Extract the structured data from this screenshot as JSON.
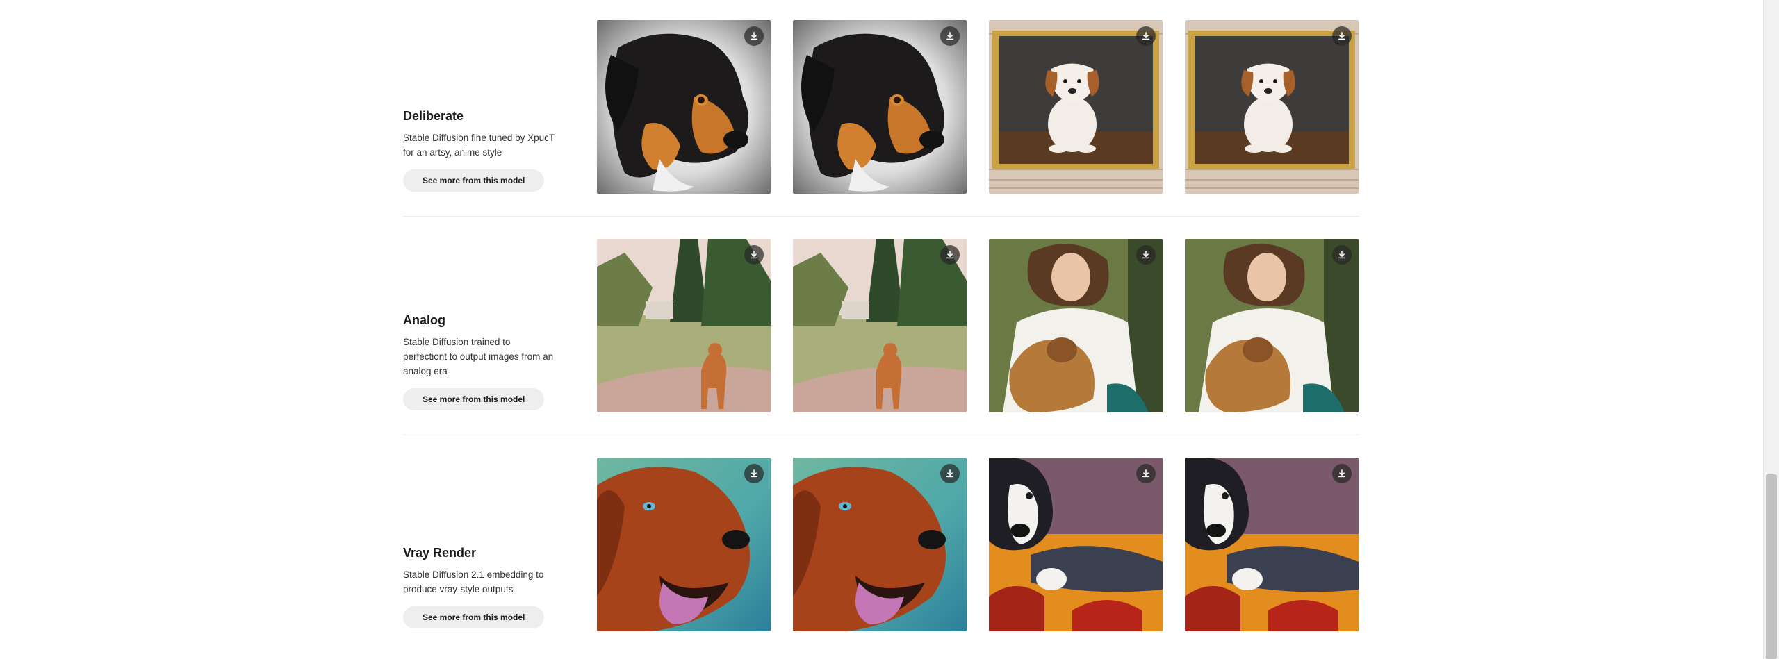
{
  "models": [
    {
      "name": "Deliberate",
      "description_lines": [
        "Stable Diffusion fine tuned by XpucT",
        "for an artsy, anime style"
      ],
      "button_label": "See more from this model",
      "images": [
        "rottweiler-portrait",
        "rottweiler-portrait",
        "framed-beagle",
        "framed-beagle"
      ]
    },
    {
      "name": "Analog",
      "description_lines": [
        "Stable Diffusion trained to",
        "perfectiont to output images from an",
        "analog era"
      ],
      "button_label": "See more from this model",
      "images": [
        "retriever-in-field",
        "retriever-in-field",
        "woman-with-dog",
        "woman-with-dog"
      ]
    },
    {
      "name": "Vray Render",
      "description_lines": [
        "Stable Diffusion 2.1 embedding to",
        "produce vray-style outputs"
      ],
      "button_label": "See more from this model",
      "images": [
        "setter-tongue-out",
        "setter-tongue-out",
        "dog-on-couch",
        "dog-on-couch"
      ]
    }
  ],
  "icons": {
    "download": "download-icon"
  },
  "colors": {
    "button_bg": "#eeeeee",
    "divider": "#ededed",
    "download_bg": "#2a2a2a"
  }
}
